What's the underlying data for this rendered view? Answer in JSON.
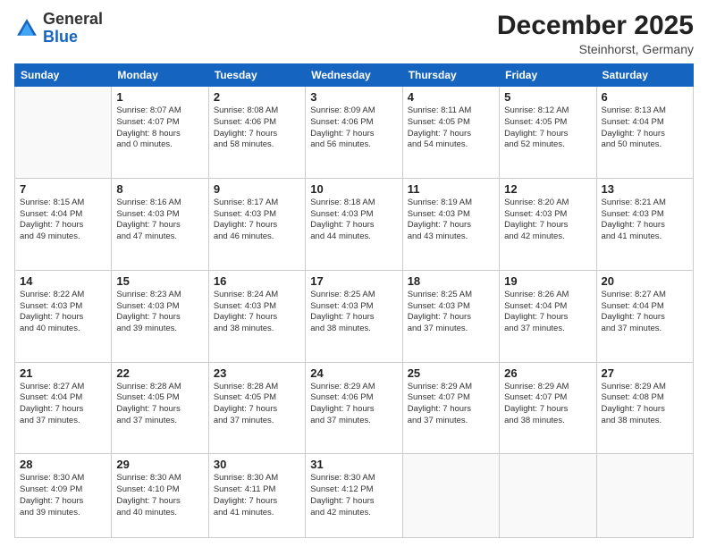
{
  "header": {
    "logo_general": "General",
    "logo_blue": "Blue",
    "month": "December 2025",
    "location": "Steinhorst, Germany"
  },
  "weekdays": [
    "Sunday",
    "Monday",
    "Tuesday",
    "Wednesday",
    "Thursday",
    "Friday",
    "Saturday"
  ],
  "weeks": [
    [
      {
        "day": "",
        "info": ""
      },
      {
        "day": "1",
        "info": "Sunrise: 8:07 AM\nSunset: 4:07 PM\nDaylight: 8 hours\nand 0 minutes."
      },
      {
        "day": "2",
        "info": "Sunrise: 8:08 AM\nSunset: 4:06 PM\nDaylight: 7 hours\nand 58 minutes."
      },
      {
        "day": "3",
        "info": "Sunrise: 8:09 AM\nSunset: 4:06 PM\nDaylight: 7 hours\nand 56 minutes."
      },
      {
        "day": "4",
        "info": "Sunrise: 8:11 AM\nSunset: 4:05 PM\nDaylight: 7 hours\nand 54 minutes."
      },
      {
        "day": "5",
        "info": "Sunrise: 8:12 AM\nSunset: 4:05 PM\nDaylight: 7 hours\nand 52 minutes."
      },
      {
        "day": "6",
        "info": "Sunrise: 8:13 AM\nSunset: 4:04 PM\nDaylight: 7 hours\nand 50 minutes."
      }
    ],
    [
      {
        "day": "7",
        "info": "Sunrise: 8:15 AM\nSunset: 4:04 PM\nDaylight: 7 hours\nand 49 minutes."
      },
      {
        "day": "8",
        "info": "Sunrise: 8:16 AM\nSunset: 4:03 PM\nDaylight: 7 hours\nand 47 minutes."
      },
      {
        "day": "9",
        "info": "Sunrise: 8:17 AM\nSunset: 4:03 PM\nDaylight: 7 hours\nand 46 minutes."
      },
      {
        "day": "10",
        "info": "Sunrise: 8:18 AM\nSunset: 4:03 PM\nDaylight: 7 hours\nand 44 minutes."
      },
      {
        "day": "11",
        "info": "Sunrise: 8:19 AM\nSunset: 4:03 PM\nDaylight: 7 hours\nand 43 minutes."
      },
      {
        "day": "12",
        "info": "Sunrise: 8:20 AM\nSunset: 4:03 PM\nDaylight: 7 hours\nand 42 minutes."
      },
      {
        "day": "13",
        "info": "Sunrise: 8:21 AM\nSunset: 4:03 PM\nDaylight: 7 hours\nand 41 minutes."
      }
    ],
    [
      {
        "day": "14",
        "info": "Sunrise: 8:22 AM\nSunset: 4:03 PM\nDaylight: 7 hours\nand 40 minutes."
      },
      {
        "day": "15",
        "info": "Sunrise: 8:23 AM\nSunset: 4:03 PM\nDaylight: 7 hours\nand 39 minutes."
      },
      {
        "day": "16",
        "info": "Sunrise: 8:24 AM\nSunset: 4:03 PM\nDaylight: 7 hours\nand 38 minutes."
      },
      {
        "day": "17",
        "info": "Sunrise: 8:25 AM\nSunset: 4:03 PM\nDaylight: 7 hours\nand 38 minutes."
      },
      {
        "day": "18",
        "info": "Sunrise: 8:25 AM\nSunset: 4:03 PM\nDaylight: 7 hours\nand 37 minutes."
      },
      {
        "day": "19",
        "info": "Sunrise: 8:26 AM\nSunset: 4:04 PM\nDaylight: 7 hours\nand 37 minutes."
      },
      {
        "day": "20",
        "info": "Sunrise: 8:27 AM\nSunset: 4:04 PM\nDaylight: 7 hours\nand 37 minutes."
      }
    ],
    [
      {
        "day": "21",
        "info": "Sunrise: 8:27 AM\nSunset: 4:04 PM\nDaylight: 7 hours\nand 37 minutes."
      },
      {
        "day": "22",
        "info": "Sunrise: 8:28 AM\nSunset: 4:05 PM\nDaylight: 7 hours\nand 37 minutes."
      },
      {
        "day": "23",
        "info": "Sunrise: 8:28 AM\nSunset: 4:05 PM\nDaylight: 7 hours\nand 37 minutes."
      },
      {
        "day": "24",
        "info": "Sunrise: 8:29 AM\nSunset: 4:06 PM\nDaylight: 7 hours\nand 37 minutes."
      },
      {
        "day": "25",
        "info": "Sunrise: 8:29 AM\nSunset: 4:07 PM\nDaylight: 7 hours\nand 37 minutes."
      },
      {
        "day": "26",
        "info": "Sunrise: 8:29 AM\nSunset: 4:07 PM\nDaylight: 7 hours\nand 38 minutes."
      },
      {
        "day": "27",
        "info": "Sunrise: 8:29 AM\nSunset: 4:08 PM\nDaylight: 7 hours\nand 38 minutes."
      }
    ],
    [
      {
        "day": "28",
        "info": "Sunrise: 8:30 AM\nSunset: 4:09 PM\nDaylight: 7 hours\nand 39 minutes."
      },
      {
        "day": "29",
        "info": "Sunrise: 8:30 AM\nSunset: 4:10 PM\nDaylight: 7 hours\nand 40 minutes."
      },
      {
        "day": "30",
        "info": "Sunrise: 8:30 AM\nSunset: 4:11 PM\nDaylight: 7 hours\nand 41 minutes."
      },
      {
        "day": "31",
        "info": "Sunrise: 8:30 AM\nSunset: 4:12 PM\nDaylight: 7 hours\nand 42 minutes."
      },
      {
        "day": "",
        "info": ""
      },
      {
        "day": "",
        "info": ""
      },
      {
        "day": "",
        "info": ""
      }
    ]
  ]
}
